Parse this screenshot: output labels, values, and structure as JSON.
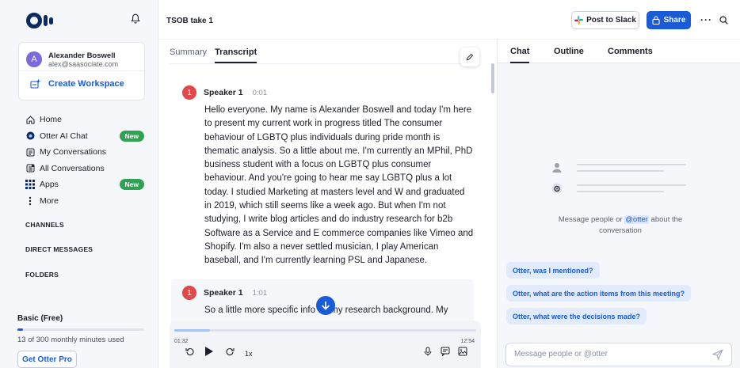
{
  "sidebar": {
    "user": {
      "initial": "A",
      "name": "Alexander Boswell",
      "email": "alex@saasociate.com"
    },
    "create_workspace": "Create Workspace",
    "nav": [
      {
        "label": "Home",
        "icon": "home-icon"
      },
      {
        "label": "Otter AI Chat",
        "icon": "otter-chat-icon",
        "badge": "New"
      },
      {
        "label": "My Conversations",
        "icon": "conversations-icon"
      },
      {
        "label": "All Conversations",
        "icon": "all-conversations-icon"
      },
      {
        "label": "Apps",
        "icon": "apps-grid-icon",
        "badge": "New"
      },
      {
        "label": "More",
        "icon": "more-vertical-icon"
      }
    ],
    "sections": {
      "channels": "CHANNELS",
      "direct_messages": "DIRECT MESSAGES",
      "folders": "FOLDERS"
    },
    "plan": {
      "title": "Basic (Free)",
      "usage": "13 of 300 monthly minutes used",
      "used_fraction": 0.043
    },
    "upgrade_label": "Get Otter Pro"
  },
  "topbar": {
    "meeting_title": "TSOB take 1",
    "slack_label": "Post to Slack",
    "share_label": "Share",
    "more_label": "···"
  },
  "transcript": {
    "tabs": [
      {
        "label": "Summary",
        "active": false
      },
      {
        "label": "Transcript",
        "active": true
      }
    ],
    "segments": [
      {
        "speaker_num": "1",
        "speaker": "Speaker 1",
        "time": "0:01",
        "text": "Hello everyone. My name is Alexander Boswell and today I'm here to present my current work in progress titled The consumer behaviour of LGBTQ plus individuals during pride month is thematic analysis. So a little about me. I'm currently an MPhil, PhD business student with a focus on LGBTQ plus consumer behaviour. And you're going to hear me say LGBTQ plus a lot today. I studied Marketing at masters level and W and graduated in 2019, which still seems like a week ago. But when I'm not studying, I write blog articles and do industry research for b2b Software as a Service and E commerce companies like Vimeo and Shopify. I'm also a never settled musician, I play American baseball, and I'm currently learning PSL and Japanese."
      },
      {
        "speaker_num": "1",
        "speaker": "Speaker 1",
        "time": "1:01",
        "text": "So a little more specific info on my research background. My"
      }
    ]
  },
  "player": {
    "current_time": "01:32",
    "total_time": "12:54",
    "progress_fraction": 0.119,
    "speed": "1x"
  },
  "chat": {
    "tabs": [
      {
        "label": "Chat",
        "active": true
      },
      {
        "label": "Outline",
        "active": false
      },
      {
        "label": "Comments",
        "active": false
      }
    ],
    "empty_message_before": "Message people or ",
    "empty_message_mention": "@otter",
    "empty_message_after": " about the conversation",
    "suggestions": [
      "Otter, was I mentioned?",
      "Otter, what are the action items from this meeting?",
      "Otter, what were the decisions made?"
    ],
    "input_placeholder": "Message people or @otter"
  },
  "colors": {
    "accent": "#1a5bd8",
    "brand": "#0a2a66",
    "speaker": "#e0484a",
    "new_badge": "#2fa353"
  }
}
